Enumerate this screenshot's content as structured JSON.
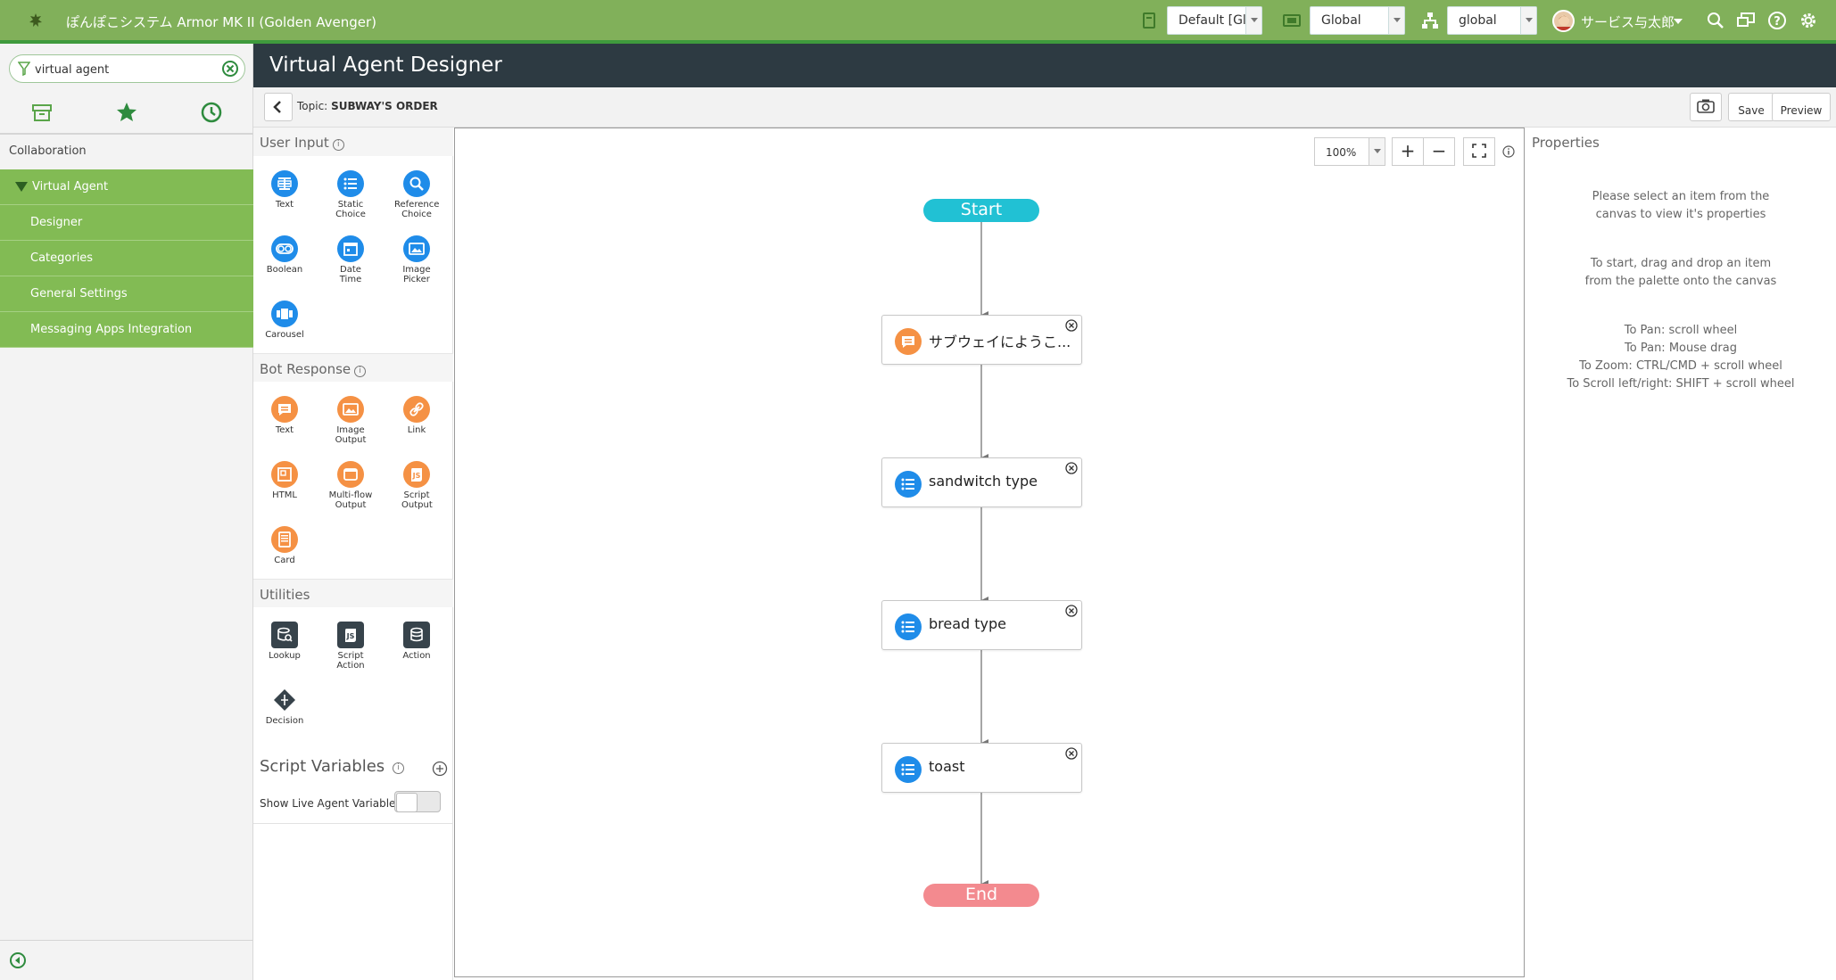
{
  "banner": {
    "title": "ぽんぽこシステム Armor MK II (Golden Avenger)",
    "update_set": "Default [Globa",
    "application": "Global",
    "domain": "global",
    "user_name": "サービス与太郎",
    "colors": {
      "banner": "#81b05a",
      "accent": "#3f9a3d"
    }
  },
  "nav": {
    "filter_value": "virtual agent",
    "tabs": [
      "all-apps-icon",
      "star-icon",
      "history-icon"
    ],
    "section": "Collaboration",
    "items": [
      {
        "label": "Virtual Agent"
      },
      {
        "label": "Designer"
      },
      {
        "label": "Categories"
      },
      {
        "label": "General Settings"
      },
      {
        "label": "Messaging Apps Integration"
      }
    ]
  },
  "page": {
    "title": "Virtual Agent Designer",
    "topic_prefix": "Topic:",
    "topic_name": "SUBWAY'S ORDER",
    "buttons": {
      "save": "Save",
      "preview": "Preview"
    }
  },
  "palette": {
    "user_input": {
      "heading": "User Input",
      "items": [
        {
          "label": "Text",
          "icon": "text-input-icon"
        },
        {
          "label": "Static Choice",
          "icon": "list-icon"
        },
        {
          "label": "Reference Choice",
          "icon": "search-icon"
        },
        {
          "label": "Boolean",
          "icon": "toggle-icon"
        },
        {
          "label": "Date Time",
          "icon": "calendar-icon"
        },
        {
          "label": "Image Picker",
          "icon": "image-icon"
        },
        {
          "label": "Carousel",
          "icon": "carousel-icon"
        }
      ]
    },
    "bot_response": {
      "heading": "Bot Response",
      "items": [
        {
          "label": "Text",
          "icon": "chat-icon"
        },
        {
          "label": "Image Output",
          "icon": "image-icon"
        },
        {
          "label": "Link",
          "icon": "link-icon"
        },
        {
          "label": "HTML",
          "icon": "html-icon"
        },
        {
          "label": "Multi-flow Output",
          "icon": "window-icon"
        },
        {
          "label": "Script Output",
          "icon": "script-icon"
        },
        {
          "label": "Card",
          "icon": "card-icon"
        }
      ]
    },
    "utilities": {
      "heading": "Utilities",
      "items": [
        {
          "label": "Lookup",
          "icon": "database-search-icon"
        },
        {
          "label": "Script Action",
          "icon": "script-icon"
        },
        {
          "label": "Action",
          "icon": "database-icon"
        },
        {
          "label": "Decision",
          "icon": "decision-icon"
        }
      ]
    },
    "script_variables": {
      "heading": "Script Variables",
      "live_label": "Show Live Agent Variables",
      "live_enabled": false
    }
  },
  "canvas": {
    "zoom": "100%",
    "start_label": "Start",
    "end_label": "End",
    "nodes": [
      {
        "label": "サブウェイにようこ...",
        "kind": "bot-text",
        "color": "#f59144"
      },
      {
        "label": "sandwitch type",
        "kind": "static-choice",
        "color": "#1f8ce9"
      },
      {
        "label": "bread type",
        "kind": "static-choice",
        "color": "#1f8ce9"
      },
      {
        "label": "toast",
        "kind": "static-choice",
        "color": "#1f8ce9"
      }
    ]
  },
  "properties": {
    "title": "Properties",
    "hint1": "Please select an item from the canvas to view it's properties",
    "hint2": "To start, drag and drop an item from the palette onto the canvas",
    "tips": [
      "To Pan: scroll wheel",
      "To Pan: Mouse drag",
      "To Zoom: CTRL/CMD + scroll wheel",
      "To Scroll left/right: SHIFT + scroll wheel"
    ]
  }
}
